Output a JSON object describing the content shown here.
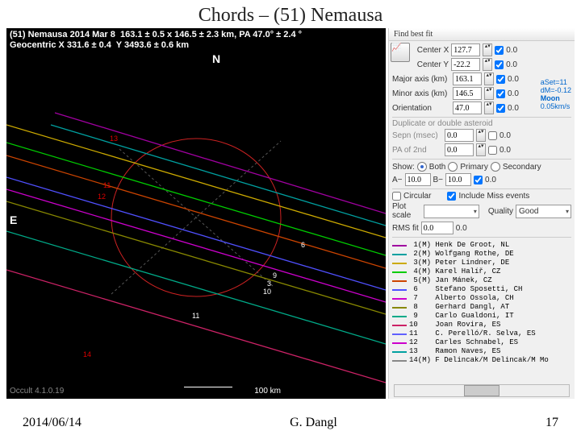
{
  "title": "Chords – (51) Nemausa",
  "plot": {
    "header1": "(51) Nemausa 2014 Mar 8  163.1 ± 0.5 x 146.5 ± 2.3 km, PA 47.0° ± 2.4 °",
    "header2": "Geocentric X 331.6 ± 0.4  Y 3493.6 ± 0.6 km",
    "north": "N",
    "east": "E",
    "software": "Occult 4.1.0.19",
    "scale": "100 km"
  },
  "panel": {
    "tab": "Find best fit",
    "centerX": {
      "label": "Center X",
      "value": "127.7",
      "err": "0.0"
    },
    "centerY": {
      "label": "Center Y",
      "value": "-22.2",
      "err": "0.0"
    },
    "major": {
      "label": "Major axis (km)",
      "value": "163.1",
      "err": "0.0"
    },
    "minor": {
      "label": "Minor axis (km)",
      "value": "146.5",
      "err": "0.0"
    },
    "orient": {
      "label": "Orientation",
      "value": "47.0",
      "err": "0.0"
    },
    "note1": "aSet=11",
    "note2": "dM=-0.12",
    "note3": "Moon",
    "note4": "0.05km/s",
    "doubleHeader": "Duplicate or double asteroid",
    "sepn": {
      "label": "Sepn (msec)",
      "value": "0.0",
      "err": "0.0"
    },
    "pa2": {
      "label": "PA of 2nd",
      "value": "0.0",
      "err": "0.0"
    },
    "show": {
      "label": "Show:",
      "both": "Both",
      "primary": "Primary",
      "secondary": "Secondary"
    },
    "Aminus": "A−",
    "AminusVal": "10.0",
    "Bminus": "B−",
    "BminusVal": "10.0",
    "ABerr": "0.0",
    "circular": "Circular",
    "includeMiss": "Include Miss events",
    "plotScale": {
      "label": "Plot scale",
      "value": " "
    },
    "quality": {
      "label": "Quality",
      "value": "Good"
    },
    "rms": {
      "label": "RMS fit",
      "value": "0.0",
      "err": "0.0"
    }
  },
  "chart_data": {
    "type": "occultation-chords",
    "asteroid": "(51) Nemausa",
    "date": "2014 Mar 8",
    "ellipse_fit": {
      "major_km": 163.1,
      "major_sigma": 0.5,
      "minor_km": 146.5,
      "minor_sigma": 2.3,
      "pa_deg": 47.0,
      "pa_sigma": 2.4
    },
    "geocentric": {
      "X_km": 331.6,
      "X_sigma": 0.4,
      "Y_km": 3493.6,
      "Y_sigma": 0.6
    },
    "observers": [
      {
        "n": 1,
        "tag": "(M)",
        "name": "Henk De Groot, NL",
        "color": "#a000a0"
      },
      {
        "n": 2,
        "tag": "(M)",
        "name": "Wolfgang Rothe, DE",
        "color": "#00a0a0"
      },
      {
        "n": 3,
        "tag": "(M)",
        "name": "Peter Lindner, DE",
        "color": "#ccaa00"
      },
      {
        "n": 4,
        "tag": "(M)",
        "name": "Karel Halíř, CZ",
        "color": "#00cc00"
      },
      {
        "n": 5,
        "tag": "(M)",
        "name": "Jan Mánek, CZ",
        "color": "#cc4400"
      },
      {
        "n": 6,
        "tag": "",
        "name": "Stefano Sposetti, CH",
        "color": "#5050ff"
      },
      {
        "n": 7,
        "tag": "",
        "name": "Alberto Ossola, CH",
        "color": "#cc00cc"
      },
      {
        "n": 8,
        "tag": "",
        "name": "Gerhard Dangl, AT",
        "color": "#888800"
      },
      {
        "n": 9,
        "tag": "",
        "name": "Carlo Gualdoni, IT",
        "color": "#00aa88"
      },
      {
        "n": 10,
        "tag": "",
        "name": "Joan Rovira, ES",
        "color": "#cc2266"
      },
      {
        "n": 11,
        "tag": "",
        "name": "C. Perelló/R. Selva, ES",
        "color": "#6060ff"
      },
      {
        "n": 12,
        "tag": "",
        "name": "Carles Schnabel, ES",
        "color": "#cc00cc"
      },
      {
        "n": 13,
        "tag": "",
        "name": "Ramon Naves, ES",
        "color": "#00a0a0"
      },
      {
        "n": 14,
        "tag": "(M)",
        "name": "F Delincak/M Delincak/M Mo",
        "color": "#888888"
      }
    ]
  },
  "footer": {
    "date": "2014/06/14",
    "author": "G. Dangl",
    "page": "17"
  }
}
